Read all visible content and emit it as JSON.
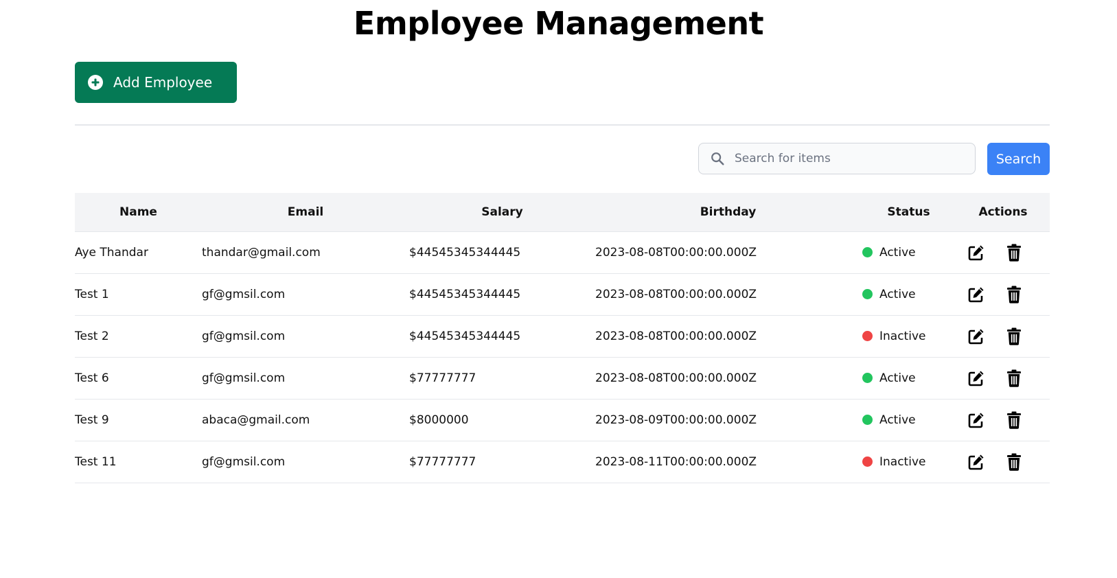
{
  "header": {
    "title": "Employee Management"
  },
  "toolbar": {
    "add_label": "Add Employee",
    "add_color": "#057a55"
  },
  "search": {
    "placeholder": "Search for items",
    "value": "",
    "button_label": "Search",
    "button_color": "#3b82f6"
  },
  "table": {
    "columns": [
      "Name",
      "Email",
      "Salary",
      "Birthday",
      "Status",
      "Actions"
    ],
    "rows": [
      {
        "name": "Aye Thandar",
        "email": "thandar@gmail.com",
        "salary": "$44545345344445",
        "birthday": "2023-08-08T00:00:00.000Z",
        "status": "Active",
        "status_color": "#22c55e"
      },
      {
        "name": "Test 1",
        "email": "gf@gmsil.com",
        "salary": "$44545345344445",
        "birthday": "2023-08-08T00:00:00.000Z",
        "status": "Active",
        "status_color": "#22c55e"
      },
      {
        "name": "Test 2",
        "email": "gf@gmsil.com",
        "salary": "$44545345344445",
        "birthday": "2023-08-08T00:00:00.000Z",
        "status": "Inactive",
        "status_color": "#ef4444"
      },
      {
        "name": "Test 6",
        "email": "gf@gmsil.com",
        "salary": "$77777777",
        "birthday": "2023-08-08T00:00:00.000Z",
        "status": "Active",
        "status_color": "#22c55e"
      },
      {
        "name": "Test 9",
        "email": "abaca@gmail.com",
        "salary": "$8000000",
        "birthday": "2023-08-09T00:00:00.000Z",
        "status": "Active",
        "status_color": "#22c55e"
      },
      {
        "name": "Test 11",
        "email": "gf@gmsil.com",
        "salary": "$77777777",
        "birthday": "2023-08-11T00:00:00.000Z",
        "status": "Inactive",
        "status_color": "#ef4444"
      }
    ],
    "actions": {
      "edit_icon": "edit-icon",
      "delete_icon": "trash-icon"
    }
  }
}
